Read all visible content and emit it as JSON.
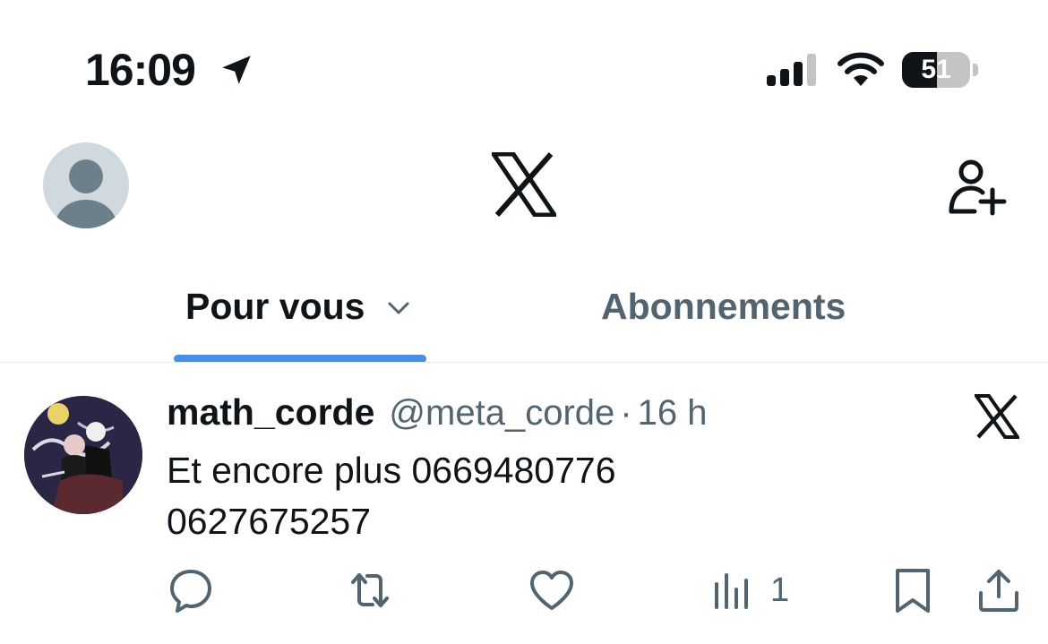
{
  "status_bar": {
    "time": "16:09",
    "battery_level": "51",
    "battery_fraction": 0.51,
    "icons": [
      "location-arrow-icon",
      "cellular-signal-icon",
      "wifi-icon",
      "battery-icon"
    ]
  },
  "header": {
    "icons": [
      "profile-avatar-icon",
      "x-logo-icon",
      "follow-user-icon"
    ]
  },
  "tabs": [
    {
      "label": "Pour vous",
      "active": true,
      "icon": "chevron-down-icon"
    },
    {
      "label": "Abonnements",
      "active": false
    }
  ],
  "colors": {
    "accent": "#4a90e2",
    "text_primary": "#0f1419",
    "text_secondary": "#536471",
    "divider": "#e1e8ed"
  },
  "tweet": {
    "author_name": "math_corde",
    "author_handle": "@meta_corde",
    "separator": "·",
    "time": "16 h",
    "text": "Et encore plus 0669480776\n0627675257",
    "views": "1",
    "icons": [
      "reply-icon",
      "retweet-icon",
      "like-icon",
      "views-icon",
      "bookmark-icon",
      "share-icon",
      "x-logo-icon"
    ]
  }
}
